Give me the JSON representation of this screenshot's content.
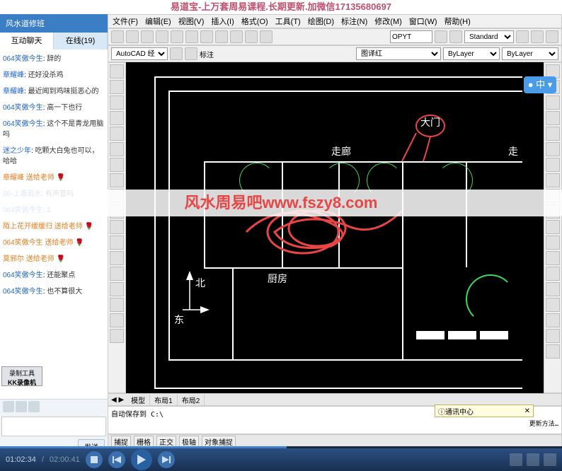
{
  "banner": "易道宝-上万套周易课程.长期更新.加微信17135680697",
  "watermark": "风水周易吧www.fszy8.com",
  "chat": {
    "title": "风水道修班",
    "tabs": {
      "active": "互动聊天",
      "inactive": "在线(19)"
    },
    "messages": [
      {
        "user": "064笑傲今生",
        "cls": "msg-user",
        "text": "辞的"
      },
      {
        "user": "章耀峰",
        "cls": "msg-user",
        "text": "还好没杀鸡"
      },
      {
        "user": "章耀峰",
        "cls": "msg-user",
        "text": "最近闻到鸡味挺恶心的"
      },
      {
        "user": "064笑傲今生",
        "cls": "msg-user",
        "text": "高一下也行"
      },
      {
        "user": "064笑傲今生",
        "cls": "msg-user",
        "text": "这个不是青龙用脑吗"
      },
      {
        "user": "迷之少年",
        "cls": "msg-user",
        "text": "吃颗大白兔也可以，哈哈"
      },
      {
        "user": "章耀峰",
        "cls": "msg-gift",
        "text": "送给老师"
      },
      {
        "user": "86-上善若水",
        "cls": "msg-user",
        "text": "有声音吗"
      },
      {
        "user": "064笑傲今生",
        "cls": "msg-user",
        "text": "1"
      },
      {
        "user": "陌上花开缓缓归",
        "cls": "msg-gift",
        "text": "送给老师"
      },
      {
        "user": "064笑傲今生",
        "cls": "msg-gift",
        "text": "送给老师"
      },
      {
        "user": "莫邪尔",
        "cls": "msg-gift",
        "text": "送给老师"
      },
      {
        "user": "064笑傲今生",
        "cls": "msg-user",
        "text": "还能聚点"
      },
      {
        "user": "064笑傲今生",
        "cls": "msg-user",
        "text": "也不算很大"
      }
    ],
    "send_label": "发送",
    "recorder": {
      "line1": "录制工具",
      "line2": "KK录像机"
    }
  },
  "cad": {
    "menus": [
      "文件(F)",
      "编辑(E)",
      "视图(V)",
      "插入(I)",
      "格式(O)",
      "工具(T)",
      "绘图(D)",
      "标注(N)",
      "修改(M)",
      "窗口(W)",
      "帮助(H)"
    ],
    "workspace_select": "AutoCAD 经典",
    "search_box": "OPYT",
    "annotation_label": "标注",
    "style_select": "Standard",
    "layer_select": "图译红",
    "linetype_select": "ByLayer",
    "lineweight_select": "ByLayer",
    "labels": {
      "damen": "大门",
      "zoulang": "走廊",
      "zou2": "走",
      "chufang": "厨房",
      "bei": "北",
      "dong": "东"
    },
    "input_indicator": "中",
    "bottom_tabs": [
      "模型",
      "布局1",
      "布局2"
    ],
    "notify_title": "通讯中心",
    "notify_link": "更新方法…",
    "cmd_text": "自动保存到 C:\\",
    "time": {
      "current": "01:02:34",
      "total": "02:00:41"
    }
  }
}
